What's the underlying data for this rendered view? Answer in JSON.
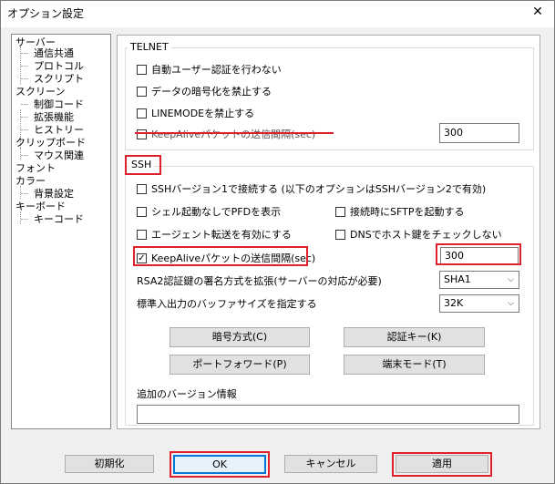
{
  "window": {
    "title": "オプション設定"
  },
  "tree": {
    "items": [
      "サーバー",
      "通信共通",
      "プロトコル",
      "スクリプト",
      "スクリーン",
      "制御コード",
      "拡張機能",
      "ヒストリー",
      "クリップボード",
      "マウス関連",
      "フォント",
      "カラー",
      "背景設定",
      "キーボード",
      "キーコード"
    ]
  },
  "telnet": {
    "label": "TELNET",
    "no_auto_login": "自動ユーザー認証を行わない",
    "no_encrypt": "データの暗号化を禁止する",
    "no_linemode": "LINEMODEを禁止する",
    "keepalive_label": "KeepAliveパケットの送信間隔(sec)",
    "keepalive_value": "300"
  },
  "ssh": {
    "label": "SSH",
    "ssh1": "SSHバージョン1で接続する (以下のオプションはSSHバージョン2で有効)",
    "shell_pfd": "シェル起動なしでPFDを表示",
    "sftp_on_connect": "接続時にSFTPを起動する",
    "agent_forward": "エージェント転送を有効にする",
    "dns_hostkey": "DNSでホスト鍵をチェックしない",
    "keepalive_label": "KeepAliveパケットの送信間隔(sec)",
    "keepalive_value": "300",
    "rsa_label": "RSA2認証鍵の署名方式を拡張(サーバーの対応が必要)",
    "rsa_value": "SHA1",
    "buffer_label": "標準入出力のバッファサイズを指定する",
    "buffer_value": "32K",
    "btn_cipher": "暗号方式(C)",
    "btn_auth_key": "認証キー(K)",
    "btn_port_forward": "ポートフォワード(P)",
    "btn_terminal_mode": "端末モード(T)",
    "extra_version_label": "追加のバージョン情報",
    "extra_version_value": ""
  },
  "footer": {
    "init": "初期化",
    "ok": "OK",
    "cancel": "キャンセル",
    "apply": "適用"
  },
  "colors": {
    "highlight": "#e0202a",
    "ok_border": "#0078d7"
  }
}
